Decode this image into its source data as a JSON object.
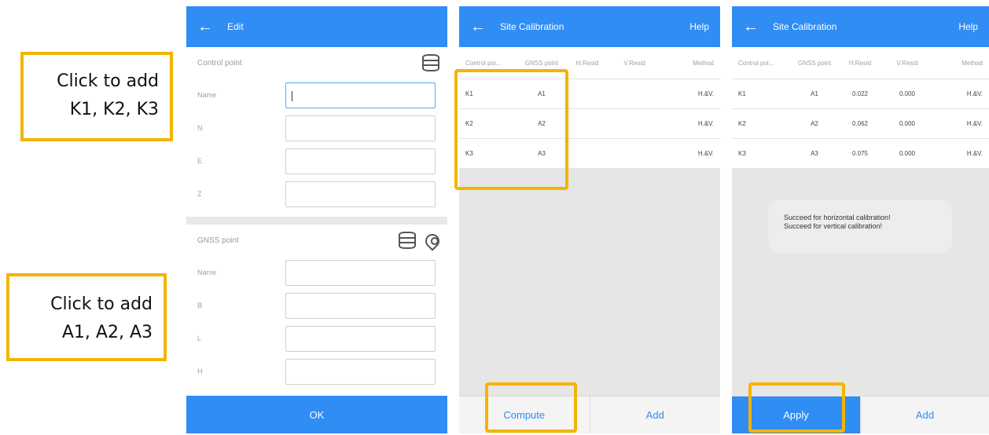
{
  "callouts": {
    "control_line1": "Click to add",
    "control_line2": "K1, K2, K3",
    "gnss_line1": "Click to add",
    "gnss_line2": "A1, A2, A3"
  },
  "edit_screen": {
    "title": "Edit",
    "control_section_label": "Control point",
    "control_fields": [
      "Name",
      "N",
      "E",
      "Z"
    ],
    "gnss_section_label": "GNSS point",
    "gnss_fields": [
      "Name",
      "B",
      "L",
      "H"
    ],
    "ok_label": "OK"
  },
  "calibration_before": {
    "title": "Site Calibration",
    "help_label": "Help",
    "headers": [
      "Control poi...",
      "GNSS point",
      "H.Resid",
      "V.Resid",
      "Method"
    ],
    "rows": [
      {
        "control": "K1",
        "gnss": "A1",
        "hres": "",
        "vres": "",
        "method": "H.&V."
      },
      {
        "control": "K2",
        "gnss": "A2",
        "hres": "",
        "vres": "",
        "method": "H.&V."
      },
      {
        "control": "K3",
        "gnss": "A3",
        "hres": "",
        "vres": "",
        "method": "H.&V."
      }
    ],
    "left_button": "Compute",
    "right_button": "Add"
  },
  "calibration_after": {
    "title": "Site Calibration",
    "help_label": "Help",
    "headers": [
      "Control poi...",
      "GNSS point",
      "H.Resid",
      "V.Resid",
      "Method"
    ],
    "rows": [
      {
        "control": "K1",
        "gnss": "A1",
        "hres": "0.022",
        "vres": "0.000",
        "method": "H.&V."
      },
      {
        "control": "K2",
        "gnss": "A2",
        "hres": "0.062",
        "vres": "0.000",
        "method": "H.&V."
      },
      {
        "control": "K3",
        "gnss": "A3",
        "hres": "0.075",
        "vres": "0.000",
        "method": "H.&V."
      }
    ],
    "toast_line1": "Succeed for horizontal calibration!",
    "toast_line2": "Succeed for vertical calibration!",
    "left_button": "Apply",
    "right_button": "Add"
  },
  "colors": {
    "appbar": "#2f8df4",
    "highlight": "#f4b400"
  }
}
